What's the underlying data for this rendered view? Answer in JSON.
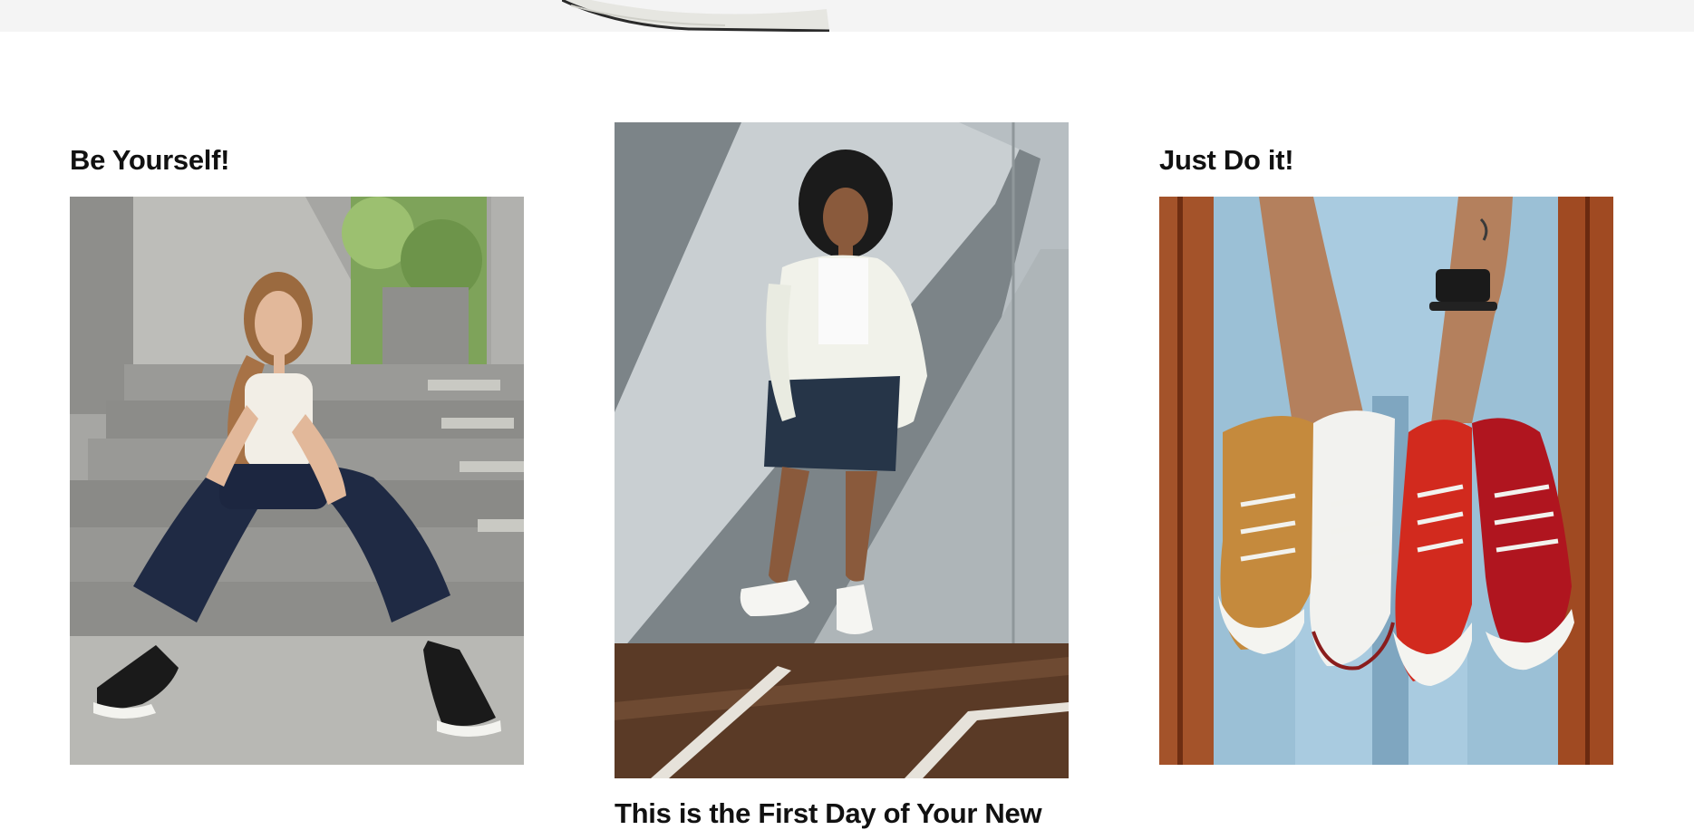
{
  "cards": [
    {
      "title": "Be Yourself!",
      "photo_icon": "person-sitting-on-steps-photo"
    },
    {
      "title": "This is the First Day of Your New",
      "photo_icon": "person-standing-by-wall-photo"
    },
    {
      "title": "Just Do it!",
      "photo_icon": "hands-holding-sneakers-photo"
    }
  ],
  "colors": {
    "background": "#ffffff",
    "banner": "#f4f4f4",
    "text": "#111111"
  }
}
